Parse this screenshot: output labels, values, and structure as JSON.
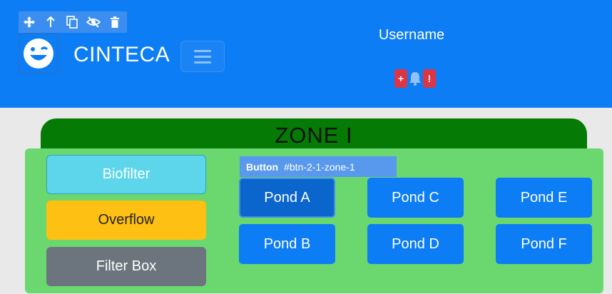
{
  "header": {
    "brand": "CINTECA",
    "username": "Username",
    "alerts": {
      "left_badge": "+",
      "right_badge": "!"
    }
  },
  "toolbar": {
    "icons": [
      "move-icon",
      "arrow-up-icon",
      "copy-icon",
      "eye-slash-icon",
      "trash-icon"
    ]
  },
  "zone": {
    "title": "ZONE I",
    "left_buttons": {
      "biofilter": "Biofilter",
      "overflow": "Overflow",
      "filter_box": "Filter Box"
    },
    "inspector": {
      "type": "Button",
      "id": "#btn-2-1-zone-1"
    },
    "ponds": {
      "a": "Pond A",
      "b": "Pond B",
      "c": "Pond C",
      "d": "Pond D",
      "e": "Pond E",
      "f": "Pond F"
    }
  },
  "colors": {
    "header_bg": "#0d7df5",
    "zone_tab": "#057a05",
    "zone_body": "#6ad86f",
    "info": "#5dd6ec",
    "warning": "#fec012",
    "secondary": "#6c757d",
    "danger": "#dc3545"
  }
}
